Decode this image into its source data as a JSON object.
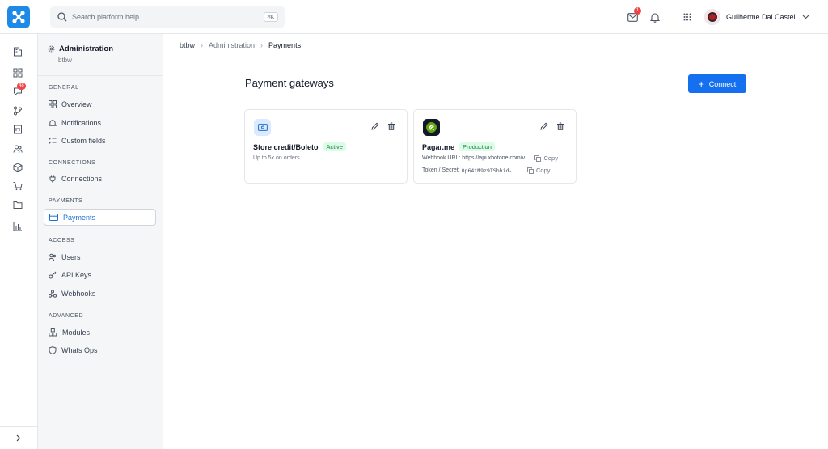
{
  "topbar": {
    "search_placeholder": "Search platform help...",
    "search_shortcut": "⌘K",
    "mail_badge": "1",
    "user_name": "Guilherme Dal Castel"
  },
  "rail": {
    "messages_badge": "48"
  },
  "sidebar": {
    "title": "Administration",
    "subtitle": "btbw",
    "sections": {
      "general": "GENERAL",
      "connections": "CONNECTIONS",
      "payments": "PAYMENTS",
      "access": "ACCESS",
      "advanced": "ADVANCED"
    },
    "items": {
      "overview": "Overview",
      "notifications": "Notifications",
      "custom_fields": "Custom fields",
      "connections": "Connections",
      "payments": "Payments",
      "users": "Users",
      "api_keys": "API Keys",
      "webhooks": "Webhooks",
      "modules": "Modules",
      "whats_ops": "Whats Ops"
    }
  },
  "breadcrumb": [
    "btbw",
    "Administration",
    "Payments"
  ],
  "main": {
    "title": "Payment gateways",
    "connect_label": "Connect"
  },
  "gateways": [
    {
      "name": "Store credit/Boleto",
      "status": "Active",
      "description": "Up to 5x on orders"
    },
    {
      "name": "Pagar.me",
      "status": "Production",
      "webhook_label": "Webhook URL:",
      "webhook_value": "https://api.xbotone.com/v...",
      "token_label": "Token / Secret:",
      "token_value": "0p64tM9z9TSbhid-...",
      "copy_label": "Copy"
    }
  ],
  "colors": {
    "accent": "#1570ef",
    "logo": "#1d8ae8",
    "status_green_bg": "#dcfce7",
    "status_green_text": "#15803d",
    "badge_red": "#ef4444"
  }
}
